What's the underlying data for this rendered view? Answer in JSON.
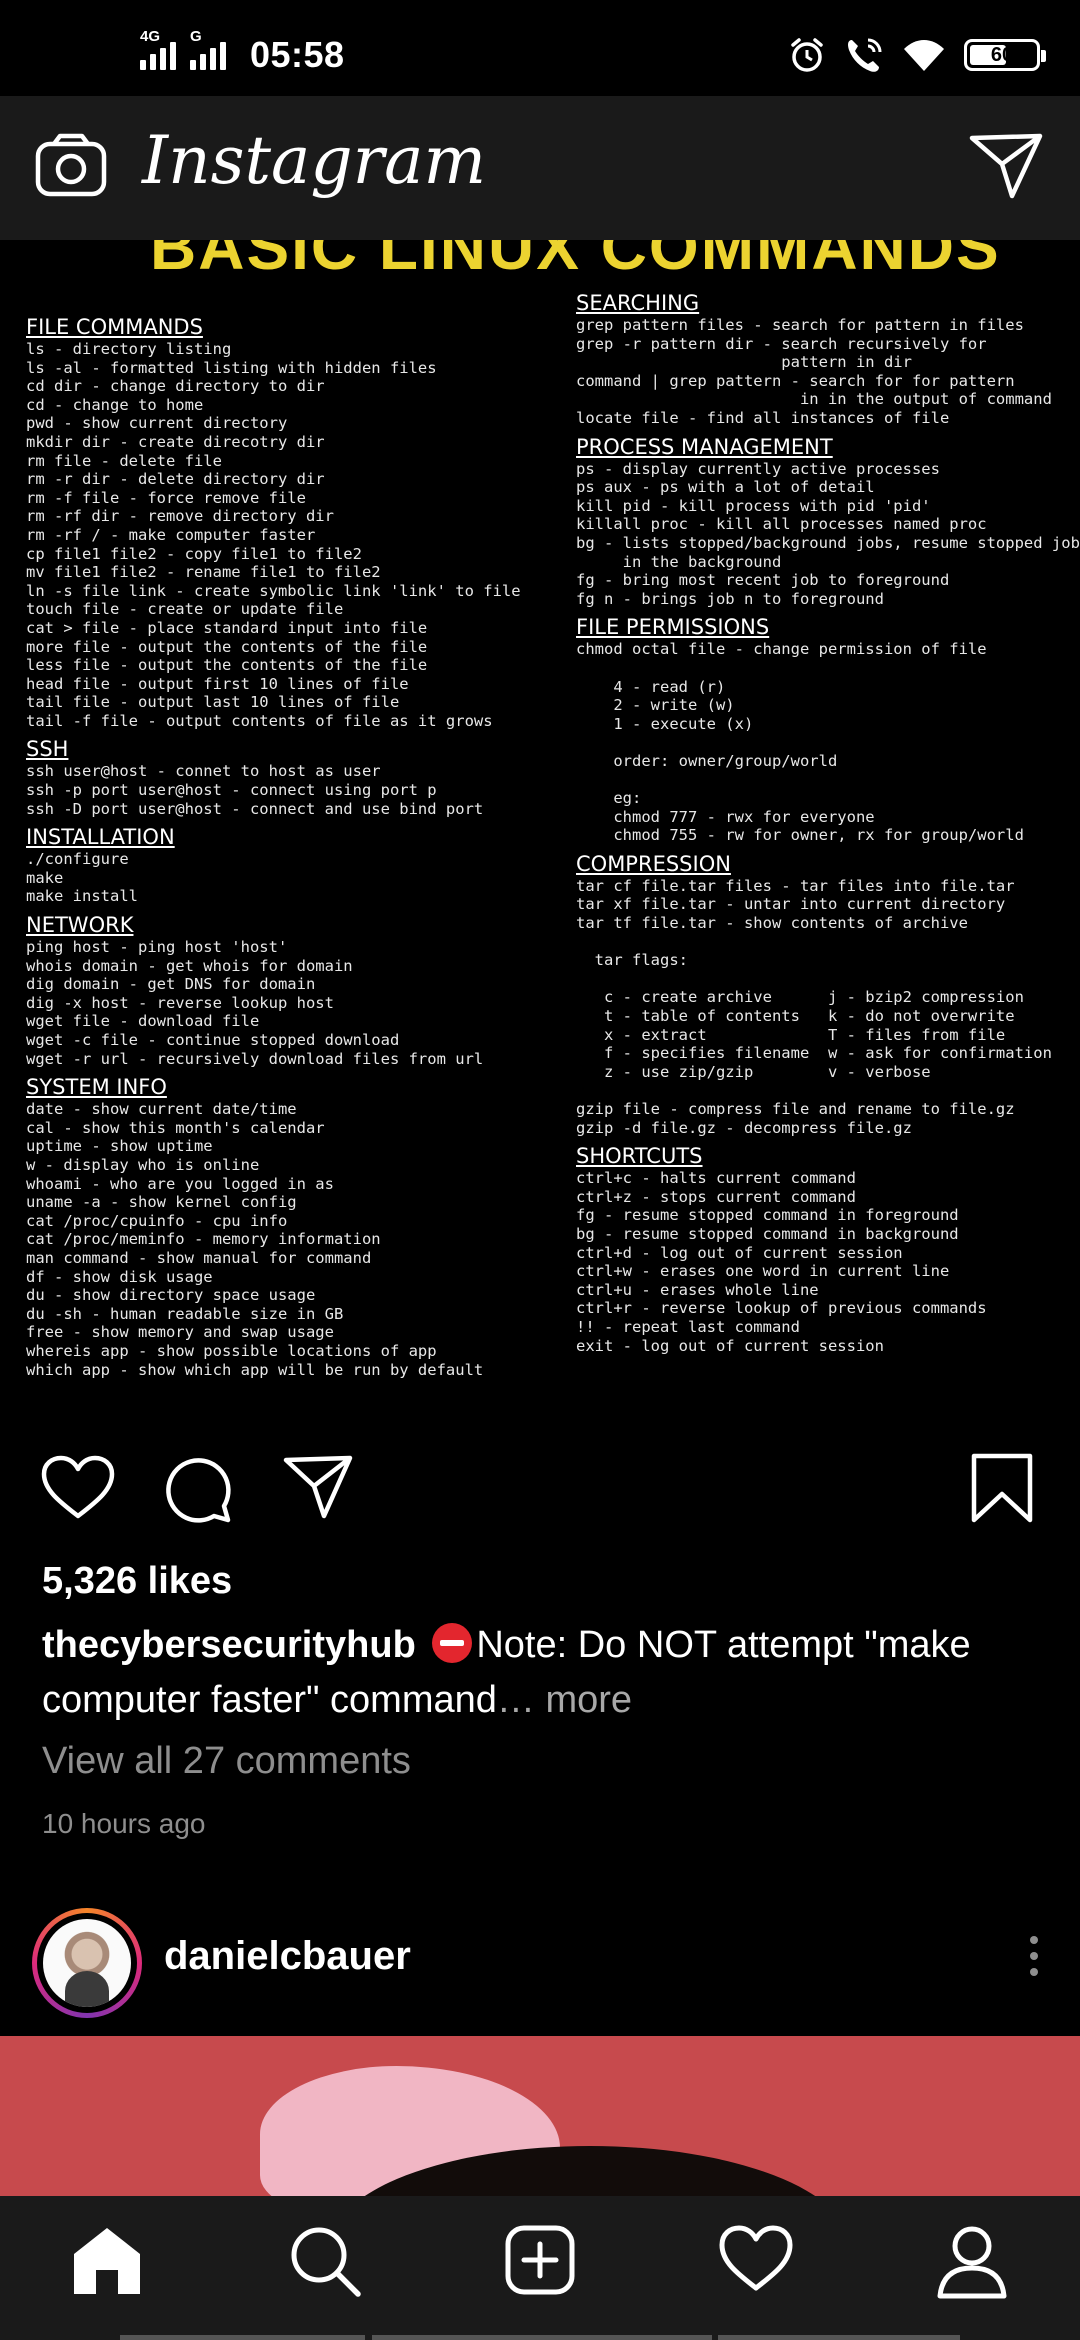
{
  "status_bar": {
    "network1": "4G",
    "network2": "G",
    "time": "05:58",
    "battery": "60",
    "battery_level": 0.6
  },
  "header": {
    "brand": "Instagram",
    "camera_icon": "camera-icon",
    "direct_icon": "paper-plane-icon"
  },
  "post": {
    "image": {
      "title": "BASIC LINUX COMMANDS",
      "left_sections": [
        {
          "heading": "FILE COMMANDS",
          "lines": [
            "ls - directory listing",
            "ls -al - formatted listing with hidden files",
            "cd dir - change directory to dir",
            "cd - change to home",
            "pwd - show current directory",
            "mkdir dir - create direcotry dir",
            "rm file - delete file",
            "rm -r dir - delete directory dir",
            "rm -f file - force remove file",
            "rm -rf dir - remove directory dir",
            "rm -rf / - make computer faster",
            "cp file1 file2 - copy file1 to file2",
            "mv file1 file2 - rename file1 to file2",
            "ln -s file link - create symbolic link 'link' to file",
            "touch file - create or update file",
            "cat > file - place standard input into file",
            "more file - output the contents of the file",
            "less file - output the contents of the file",
            "head file - output first 10 lines of file",
            "tail file - output last 10 lines of file",
            "tail -f file - output contents of file as it grows"
          ]
        },
        {
          "heading": "SSH",
          "lines": [
            "ssh user@host - connet to host as user",
            "ssh -p port user@host - connect using port p",
            "ssh -D port user@host - connect and use bind port"
          ]
        },
        {
          "heading": "INSTALLATION",
          "lines": [
            "./configure",
            "make",
            "make install"
          ]
        },
        {
          "heading": "NETWORK",
          "lines": [
            "ping host - ping host 'host'",
            "whois domain - get whois for domain",
            "dig domain - get DNS for domain",
            "dig -x host - reverse lookup host",
            "wget file - download file",
            "wget -c file - continue stopped download",
            "wget -r url - recursively download files from url"
          ]
        },
        {
          "heading": "SYSTEM INFO",
          "lines": [
            "date - show current date/time",
            "cal - show this month's calendar",
            "uptime - show uptime",
            "w - display who is online",
            "whoami - who are you logged in as",
            "uname -a - show kernel config",
            "cat /proc/cpuinfo - cpu info",
            "cat /proc/meminfo - memory information",
            "man command - show manual for command",
            "df - show disk usage",
            "du - show directory space usage",
            "du -sh - human readable size in GB",
            "free - show memory and swap usage",
            "whereis app - show possible locations of app",
            "which app - show which app will be run by default"
          ]
        }
      ],
      "right_sections": [
        {
          "heading": "SEARCHING",
          "lines": [
            "grep pattern files - search for pattern in files",
            "grep -r pattern dir - search recursively for",
            "                      pattern in dir",
            "command | grep pattern - search for for pattern",
            "                        in in the output of command",
            "locate file - find all instances of file"
          ]
        },
        {
          "heading": "PROCESS MANAGEMENT",
          "lines": [
            "ps - display currently active processes",
            "ps aux - ps with a lot of detail",
            "kill pid - kill process with pid 'pid'",
            "killall proc - kill all processes named proc",
            "bg - lists stopped/background jobs, resume stopped job",
            "     in the background",
            "fg - bring most recent job to foreground",
            "fg n - brings job n to foreground"
          ]
        },
        {
          "heading": "FILE PERMISSIONS",
          "lines": [
            "chmod octal file - change permission of file",
            "",
            "    4 - read (r)",
            "    2 - write (w)",
            "    1 - execute (x)",
            "",
            "    order: owner/group/world",
            "",
            "    eg:",
            "    chmod 777 - rwx for everyone",
            "    chmod 755 - rw for owner, rx for group/world"
          ]
        },
        {
          "heading": "COMPRESSION",
          "lines": [
            "tar cf file.tar files - tar files into file.tar",
            "tar xf file.tar - untar into current directory",
            "tar tf file.tar - show contents of archive",
            "",
            "  tar flags:",
            "",
            "   c - create archive      j - bzip2 compression",
            "   t - table of contents   k - do not overwrite",
            "   x - extract             T - files from file",
            "   f - specifies filename  w - ask for confirmation",
            "   z - use zip/gzip        v - verbose",
            "",
            "gzip file - compress file and rename to file.gz",
            "gzip -d file.gz - decompress file.gz"
          ]
        },
        {
          "heading": "SHORTCUTS",
          "lines": [
            "ctrl+c - halts current command",
            "ctrl+z - stops current command",
            "fg - resume stopped command in foreground",
            "bg - resume stopped command in background",
            "ctrl+d - log out of current session",
            "ctrl+w - erases one word in current line",
            "ctrl+u - erases whole line",
            "ctrl+r - reverse lookup of previous commands",
            "!! - repeat last command",
            "exit - log out of current session"
          ]
        }
      ]
    },
    "actions": {
      "like_icon": "heart-icon",
      "comment_icon": "comment-icon",
      "share_icon": "paper-plane-icon",
      "save_icon": "bookmark-icon"
    },
    "likes": "5,326 likes",
    "caption_user": "thecybersecurityhub",
    "caption_text": "Note: Do NOT attempt \"make computer faster\" command",
    "caption_more": "… more",
    "view_comments": "View all 27 comments",
    "time_ago": "10 hours ago"
  },
  "next_post": {
    "username": "danielcbauer"
  },
  "bottom_nav": {
    "items": [
      "home-icon",
      "search-icon",
      "add-post-icon",
      "activity-heart-icon",
      "profile-icon"
    ]
  },
  "colors": {
    "poster_title": "#ecd330",
    "story_ring": "#dd2a7b",
    "stop_emoji": "#e3262e"
  }
}
